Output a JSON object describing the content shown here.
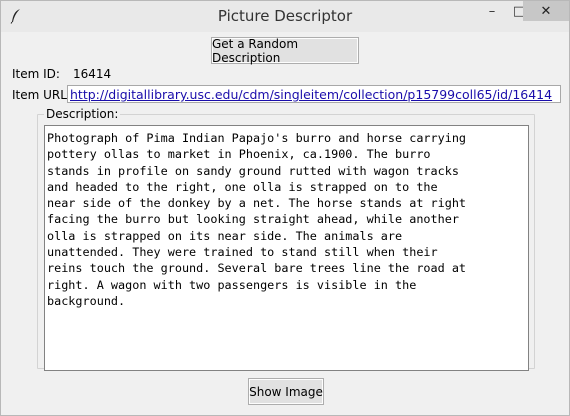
{
  "window": {
    "title": "Picture Descriptor",
    "controls": {
      "minimize": "–",
      "maximize": "□",
      "close": "✕"
    }
  },
  "toolbar": {
    "random_label": "Get a Random Description"
  },
  "item": {
    "id_label": "Item ID:",
    "id_value": "16414",
    "url_label": "Item URL:",
    "url_value": "http://digitallibrary.usc.edu/cdm/singleitem/collection/p15799coll65/id/16414"
  },
  "description": {
    "legend": "Description:",
    "text": "Photograph of Pima Indian Papajo's burro and horse carrying\npottery ollas to market in Phoenix, ca.1900. The burro\nstands in profile on sandy ground rutted with wagon tracks\nand headed to the right, one olla is strapped on to the\nnear side of the donkey by a net. The horse stands at right\nfacing the burro but looking straight ahead, while another\nolla is strapped on its near side. The animals are\nunattended. They were trained to stand still when their\nreins touch the ground. Several bare trees line the road at\nright. A wagon with two passengers is visible in the\nbackground."
  },
  "footer": {
    "show_label": "Show Image"
  },
  "icons": {
    "app": "feather-icon"
  },
  "colors": {
    "link": "#1a0dab",
    "close_bg": "#c7c7c7"
  }
}
